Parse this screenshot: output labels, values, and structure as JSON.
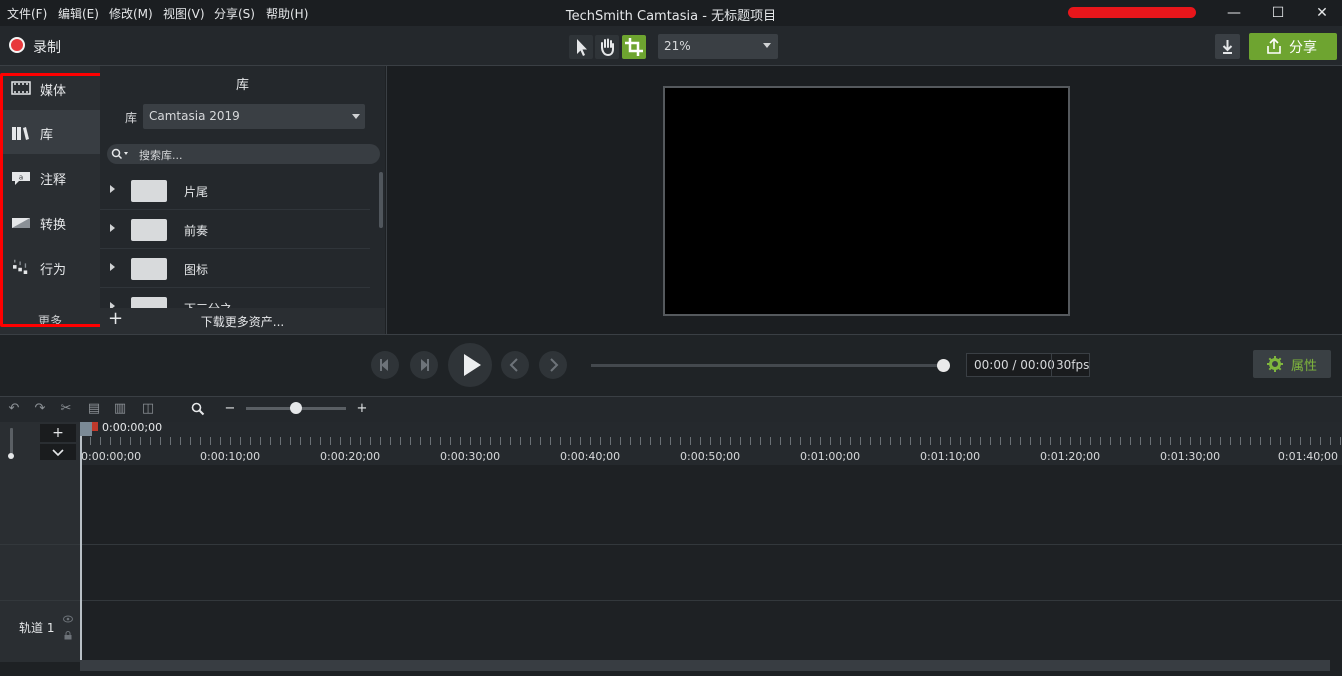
{
  "menu": [
    "文件(F)",
    "编辑(E)",
    "修改(M)",
    "视图(V)",
    "分享(S)",
    "帮助(H)"
  ],
  "app_title": "TechSmith Camtasia - 无标题项目",
  "window_controls": {
    "minimize": "—",
    "maximize": "☐",
    "close": "✕"
  },
  "toolbar": {
    "record_label": "录制",
    "zoom_value": "21%",
    "share_label": "分享"
  },
  "left_tabs": [
    {
      "label": "媒体",
      "icon": "film-icon"
    },
    {
      "label": "库",
      "icon": "books-icon"
    },
    {
      "label": "注释",
      "icon": "annotation-icon"
    },
    {
      "label": "转换",
      "icon": "transition-icon"
    },
    {
      "label": "行为",
      "icon": "behavior-icon"
    }
  ],
  "more_label": "更多",
  "library": {
    "title": "库",
    "selector_label": "库",
    "selected": "Camtasia 2019",
    "search_placeholder": "搜索库...",
    "folders": [
      "片尾",
      "前奏",
      "图标",
      "下三分之一"
    ],
    "download_more": "下载更多资产..."
  },
  "player": {
    "time": "00:00 / 00:00",
    "fps": "30fps",
    "progress": 1.0,
    "properties_label": "属性"
  },
  "timeline": {
    "playhead_time": "0:00:00;00",
    "ticks": [
      "0:00:00;00",
      "0:00:10;00",
      "0:00:20;00",
      "0:00:30;00",
      "0:00:40;00",
      "0:00:50;00",
      "0:01:00;00",
      "0:01:10;00",
      "0:01:20;00",
      "0:01:30;00",
      "0:01:40;00"
    ],
    "track_label": "轨道 1"
  }
}
